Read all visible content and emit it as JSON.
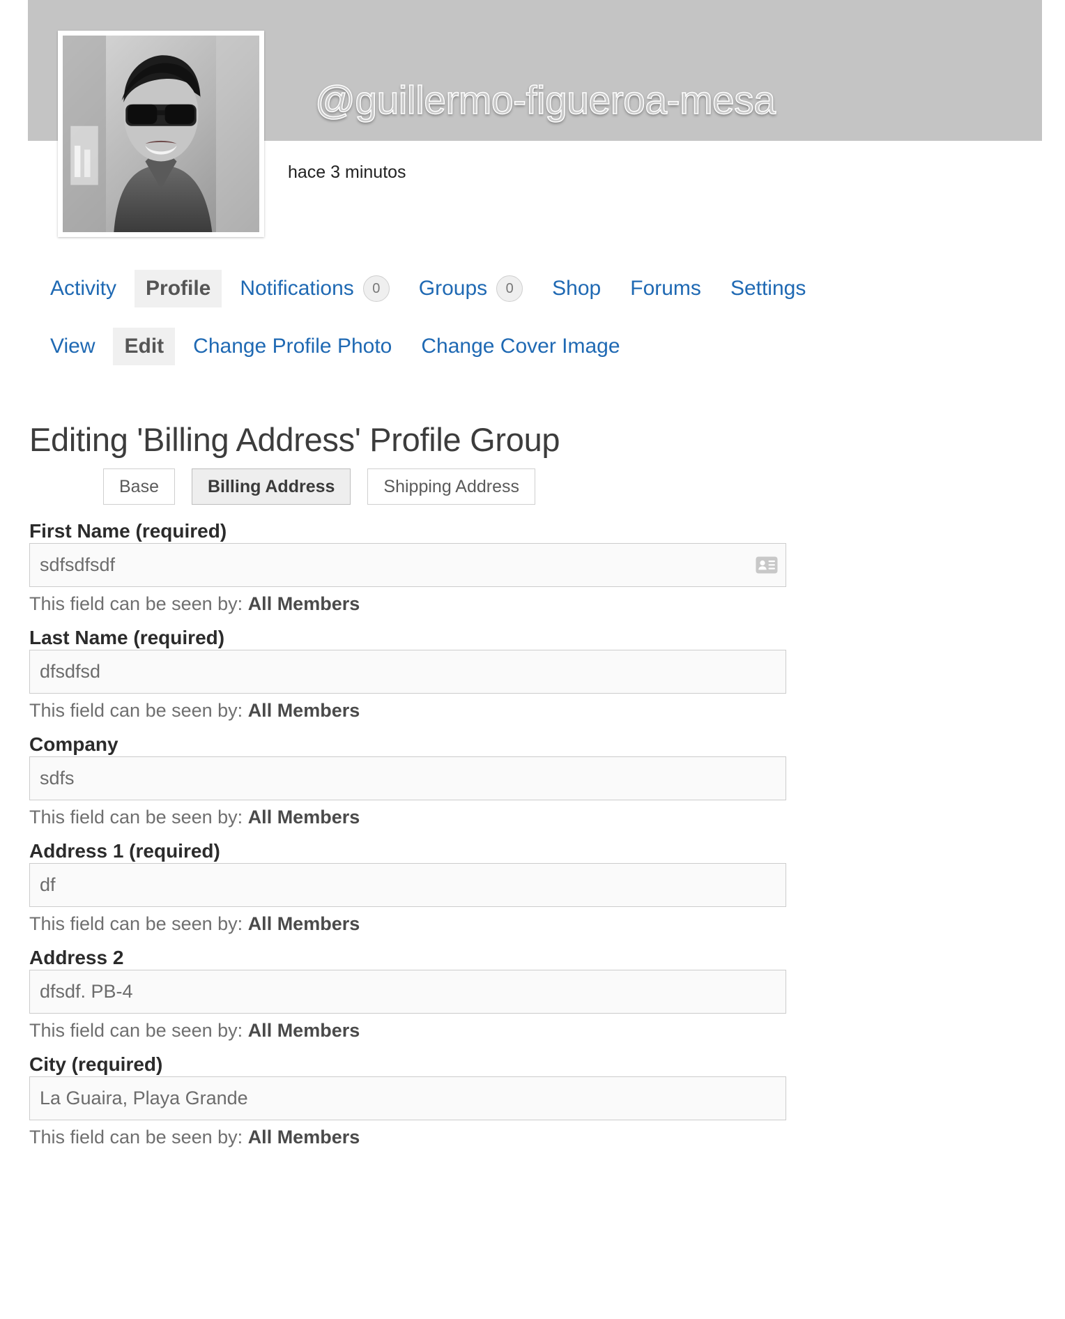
{
  "header": {
    "username": "@guillermo-figueroa-mesa",
    "activity_time": "hace 3 minutos",
    "avatar_alt": "user-avatar-photo"
  },
  "nav_primary": [
    {
      "label": "Activity",
      "current": false,
      "count": null
    },
    {
      "label": "Profile",
      "current": true,
      "count": null
    },
    {
      "label": "Notifications",
      "current": false,
      "count": "0"
    },
    {
      "label": "Groups",
      "current": false,
      "count": "0"
    },
    {
      "label": "Shop",
      "current": false,
      "count": null
    },
    {
      "label": "Forums",
      "current": false,
      "count": null
    },
    {
      "label": "Settings",
      "current": false,
      "count": null
    }
  ],
  "nav_secondary": [
    {
      "label": "View",
      "current": false
    },
    {
      "label": "Edit",
      "current": true
    },
    {
      "label": "Change Profile Photo",
      "current": false
    },
    {
      "label": "Change Cover Image",
      "current": false
    }
  ],
  "page_title": "Editing 'Billing Address' Profile Group",
  "group_tabs": [
    {
      "label": "Base",
      "current": false
    },
    {
      "label": "Billing Address",
      "current": true
    },
    {
      "label": "Shipping Address",
      "current": false
    }
  ],
  "visibility_prefix": "This field can be seen by: ",
  "visibility_value": "All Members",
  "fields": [
    {
      "label": "First Name (required)",
      "value": "sdfsdfsdf",
      "placeholder": "",
      "icon": "contact-card-icon",
      "visibility": "All Members"
    },
    {
      "label": "Last Name (required)",
      "value": "dfsdfsd",
      "placeholder": "",
      "icon": null,
      "visibility": "All Members"
    },
    {
      "label": "Company",
      "value": "sdfs",
      "placeholder": "",
      "icon": null,
      "visibility": "All Members"
    },
    {
      "label": "Address 1 (required)",
      "value": "df",
      "placeholder": "",
      "icon": null,
      "visibility": "All Members"
    },
    {
      "label": "Address 2",
      "value": "dfsdf. PB-4",
      "placeholder": "",
      "icon": null,
      "visibility": "All Members"
    },
    {
      "label": "City (required)",
      "value": "La Guaira, Playa Grande",
      "placeholder": "",
      "icon": null,
      "visibility": "All Members"
    }
  ],
  "colors": {
    "link": "#1f69b3",
    "cover_bg": "#c4c4c4",
    "current_tab_bg": "#f0f0f0",
    "input_bg": "#fafafa",
    "input_border": "#cccccc",
    "label_text": "#2b2b2b",
    "muted_text": "#6f6f6f"
  }
}
